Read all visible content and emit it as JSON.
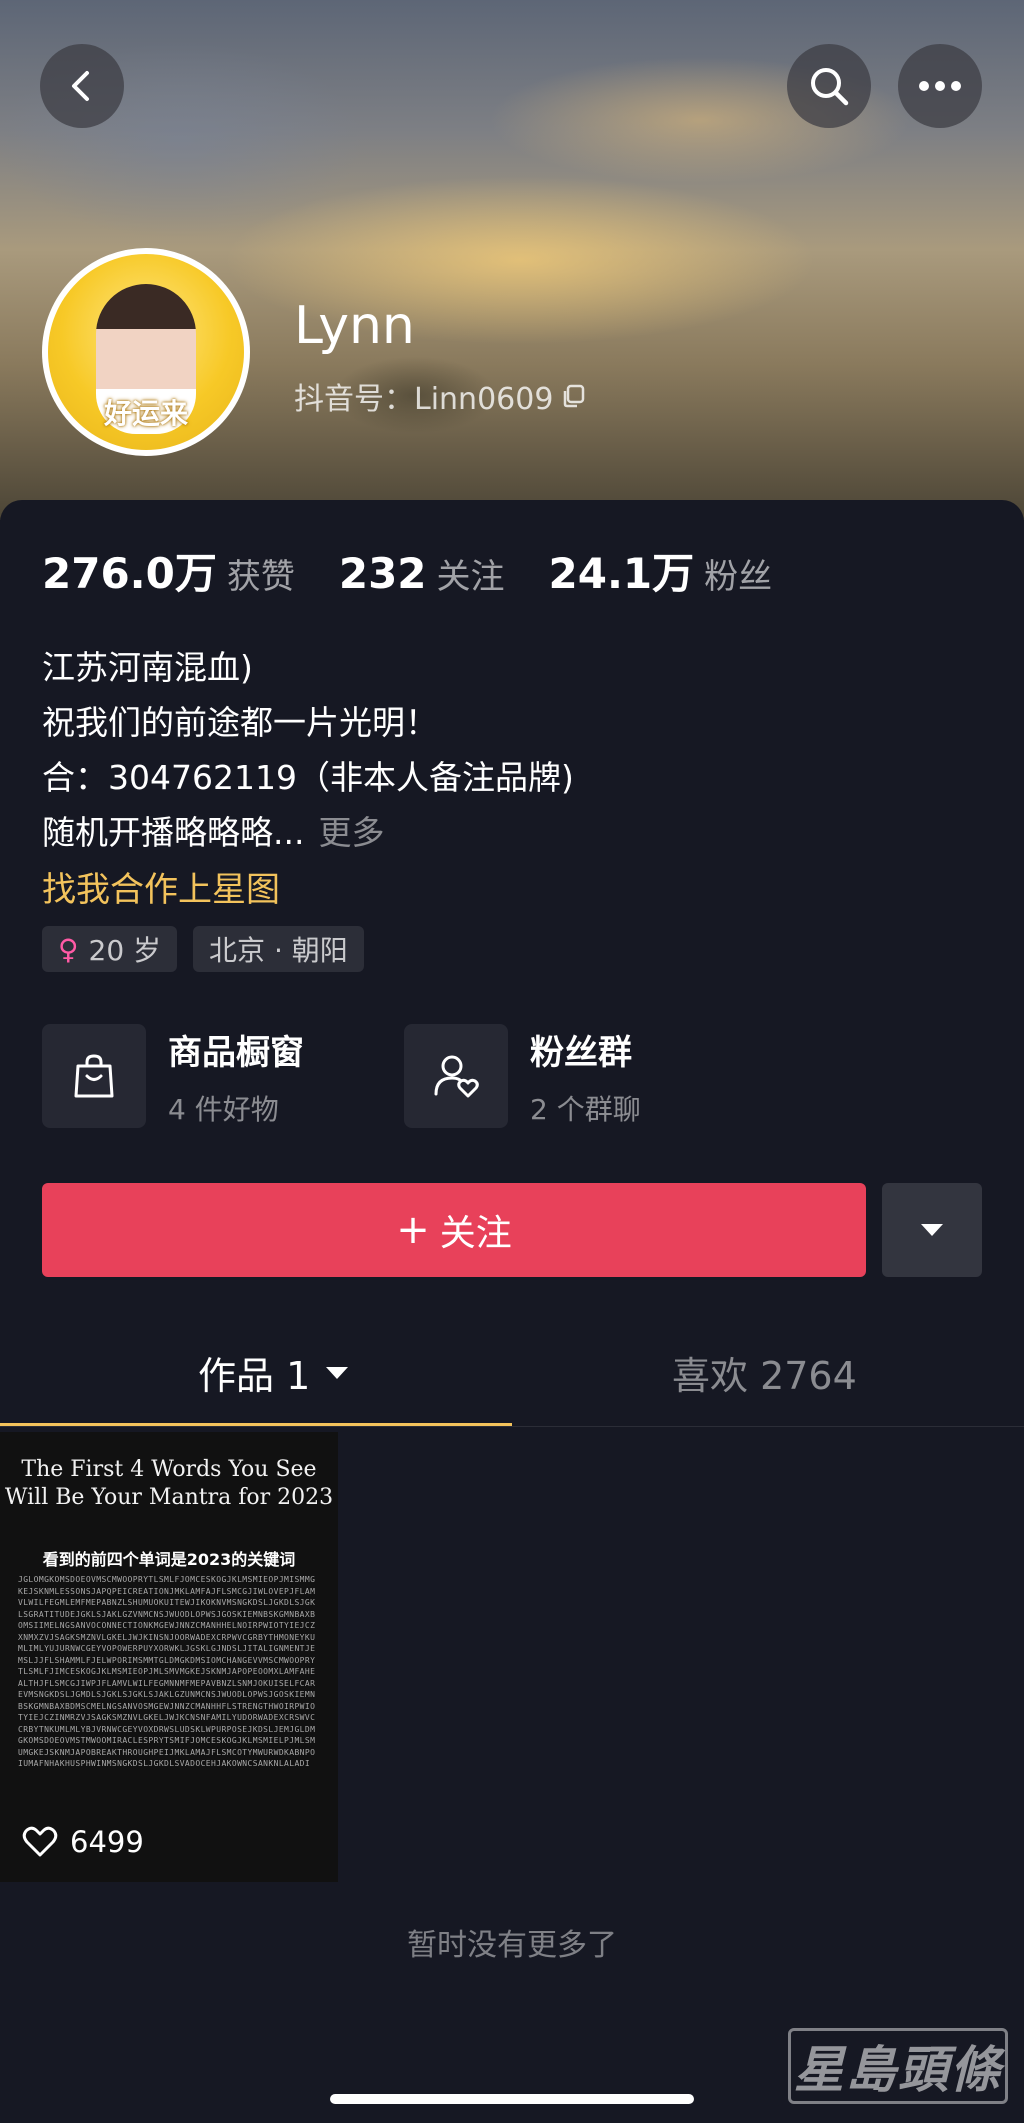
{
  "header": {
    "back_icon": "chevron-left-icon",
    "search_icon": "search-icon",
    "more_icon": "more-dots-icon"
  },
  "profile": {
    "avatar_text": "好运来",
    "name": "Lynn",
    "id_label": "抖音号：Linn0609",
    "copy_icon": "copy-icon"
  },
  "stats": [
    {
      "value": "276.0万",
      "label": "获赞"
    },
    {
      "value": "232",
      "label": "关注"
    },
    {
      "value": "24.1万",
      "label": "粉丝"
    }
  ],
  "bio": {
    "line1": "江苏河南混血)",
    "line2": "祝我们的前途都一片光明！",
    "line3": "合：304762119（非本人备注品牌)",
    "line4": "随机开播略略略...",
    "more": "更多"
  },
  "star_link": "找我合作上星图",
  "tags": {
    "age": "20 岁",
    "location": "北京 · 朝阳"
  },
  "features": {
    "shop_title": "商品橱窗",
    "shop_sub": "4 件好物",
    "fans_title": "粉丝群",
    "fans_sub": "2 个群聊"
  },
  "actions": {
    "follow": "关注"
  },
  "tabs": {
    "works": "作品 1",
    "likes": "喜欢 2764"
  },
  "video": {
    "title": "The First 4 Words You See Will Be Your Mantra for 2023",
    "subtitle": "看到的前四个单词是2023的关键词",
    "grid_text": "JGLOMGKOMSDOEOVMSCMWOOPRYTLSMLFJOMCESKOGJKLMSMIEOPJMISMMGKEJSKNMLESSONSJAPQPEICREATIONJMKLAMFAJFLSMCGJIWLOVEPJFLAMVLWILFEGMLEMFMEPABNZLSHUMUOKUITEWJIKOKNVMSNGKDSLJGKDLSJGKLSGRATITUDEJGKLSJAKLGZVNMCNSJWUODLOPWSJGOSKIEMNBSKGMNBAXBOMSIIMELNGSANVOCONNECTIONKMGEWJNNZCMANHHELNOIRPWIOTYIEJCZXNMXZVJSAGKSMZNVLGKELJWJKINSNJOORWADEXCRPWVCGRBYTHMONEYKUMLIMLYUJURNWCGEYVOPOWERPUYXORWKLJGSKLGJNDSLJITALIGNMENTJEMSLJJFLSHAMMLFJELWPORIMSMMTGLDMGKDMSIOMCHANGEVVMSCMWOOPRYTLSMLFJIMCESKOGJKLMSMIEOPJMLSMVMGKEJSKNMJAPOPEOOMXLAMFAHEALTHJFLSMCGJIWPJFLAMVLWILFEGMNNMFMEPAVBNZLSNMJOKUISELFCAREVMSNGKDSLJGMDLSJGKLSJGKLSJAKLGZUNMCNSJWUODLOPWSJGOSKIEMNBSKGMNBAXBDMSCMELNGSANVOSMGEWJNNZCMANHHFLSTRENGTHWOIRPWIOTYIEJCZINMRZVJSAGKSMZNVLGKELJWJKCNSNFAMILYUDORWADEXCRSWVCCRBYTNKUMLMLYBJVRNWCGEYVOXDRWSLUDSKLWPURPOSEJKDSLJEMJGLDMGKOMSDOEOVMSTMWOOMIRACLESPRYTSMIFJOMCESKOGJKLMSMIELPJMLSMUMGKEJSKNMJAPOBREAKTHROUGHPEIJMKLAMAJFLSMCOTYMWURWDKABNPOIUMAFNHAKHUSPHWINMSNGKDSLJGKDLSVADOCEHJAKOWNCSANKNLALADI",
    "likes": "6499",
    "heart_icon": "heart-icon"
  },
  "footer": {
    "no_more": "暂时没有更多了",
    "watermark": "星島頭條"
  }
}
